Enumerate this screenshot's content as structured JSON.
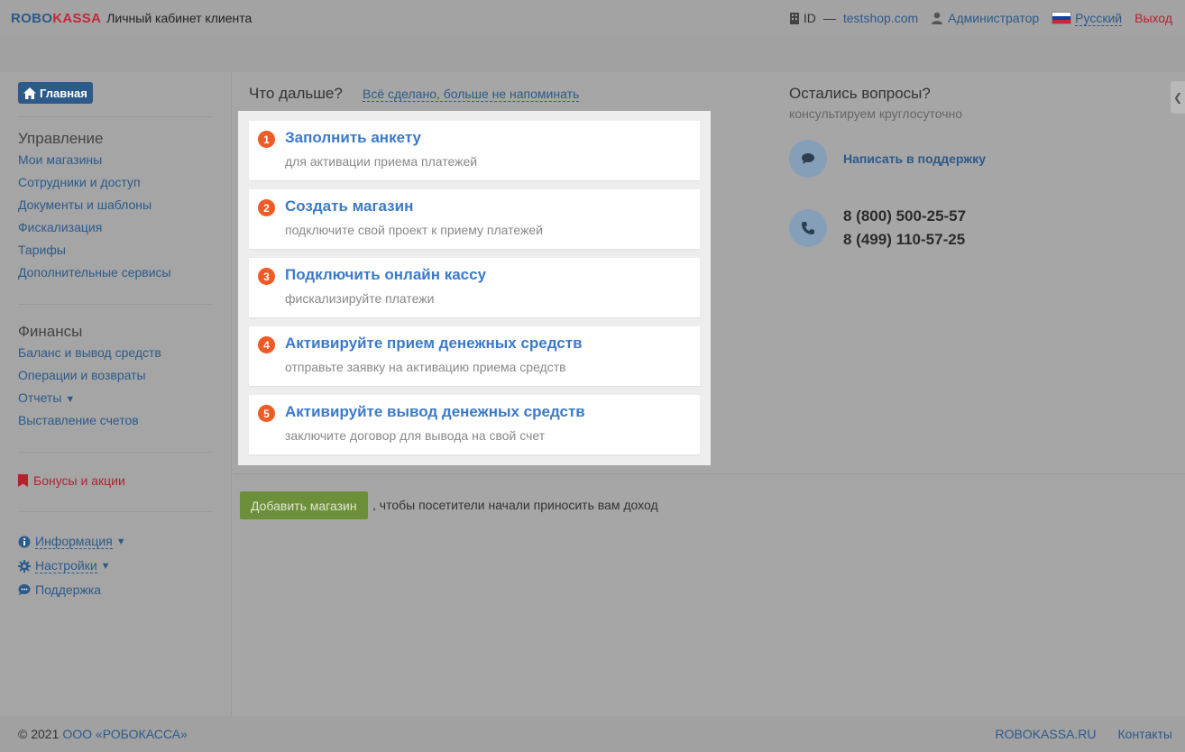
{
  "header": {
    "logo_robo": "ROBO",
    "logo_kassa": "KASSA",
    "cabinet": "Личный кабинет клиента",
    "id_label": "ID",
    "dash": "—",
    "shop": "testshop.com",
    "user": "Администратор",
    "language": "Русский",
    "logout": "Выход"
  },
  "sidebar": {
    "home": "Главная",
    "management_title": "Управление",
    "management": [
      "Мои магазины",
      "Сотрудники и доступ",
      "Документы и шаблоны",
      "Фискализация",
      "Тарифы",
      "Дополнительные сервисы"
    ],
    "finance_title": "Финансы",
    "finance": [
      "Баланс и вывод средств",
      "Операции и возвраты",
      "Отчеты",
      "Выставление счетов"
    ],
    "bonus": "Бонусы и акции",
    "info": "Информация",
    "settings": "Настройки",
    "support": "Поддержка"
  },
  "main": {
    "whatnext": "Что дальше?",
    "dismiss": "Всё сделано, больше не напоминать",
    "steps": [
      {
        "num": "1",
        "title": "Заполнить анкету",
        "desc": "для активации приема платежей"
      },
      {
        "num": "2",
        "title": "Создать магазин",
        "desc": "подключите свой проект к приему платежей"
      },
      {
        "num": "3",
        "title": "Подключить онлайн кассу",
        "desc": "фискализируйте платежи"
      },
      {
        "num": "4",
        "title": "Активируйте прием денежных средств",
        "desc": "отправьте заявку на активацию приема средств"
      },
      {
        "num": "5",
        "title": "Активируйте вывод денежных средств",
        "desc": "заключите договор для вывода на свой счет"
      }
    ],
    "add_button": "Добавить магазин",
    "add_text": ", чтобы посетители начали приносить вам доход"
  },
  "help": {
    "title": "Остались вопросы?",
    "subtitle": "консультируем круглосуточно",
    "support_link": "Написать в поддержку",
    "phone1": "8 (800) 500-25-57",
    "phone2": "8 (499) 110-57-25"
  },
  "footer": {
    "copyright": "© 2021",
    "company": "ООО «РОБОКАССА»",
    "site": "ROBOKASSA.RU",
    "contacts": "Контакты"
  }
}
